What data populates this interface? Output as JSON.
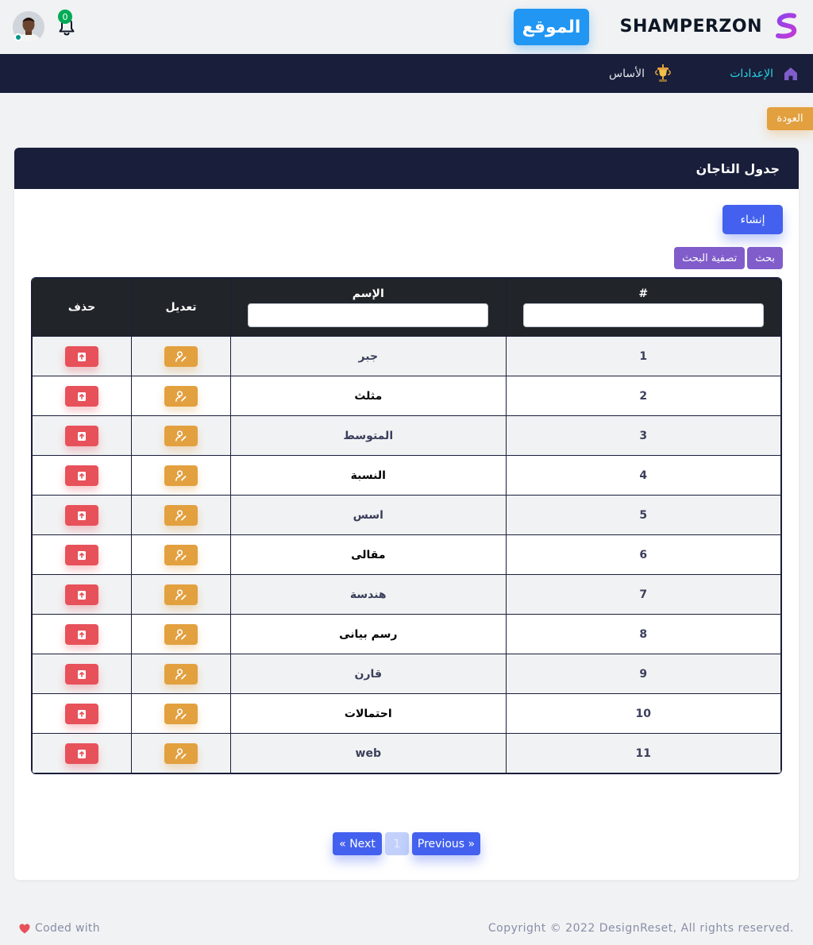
{
  "header": {
    "brand_name": "SHAMPERZON",
    "site_button": "الموقع",
    "notification_count": "0"
  },
  "nav": {
    "settings": "الإعدادات",
    "base": "الأساس"
  },
  "back_button": "العودة",
  "card": {
    "title": "جدول التاجان",
    "create_button": "إنشاء",
    "search_button": "بحث",
    "filter_button": "تصفية البحث"
  },
  "table": {
    "headers": {
      "num": "#",
      "name": "الإسم",
      "edit": "تعديل",
      "delete": "حذف"
    },
    "rows": [
      {
        "num": "1",
        "name": "جبر"
      },
      {
        "num": "2",
        "name": "مثلث"
      },
      {
        "num": "3",
        "name": "المتوسط"
      },
      {
        "num": "4",
        "name": "النسبة"
      },
      {
        "num": "5",
        "name": "اسس"
      },
      {
        "num": "6",
        "name": "مقالى"
      },
      {
        "num": "7",
        "name": "هندسة"
      },
      {
        "num": "8",
        "name": "رسم بيانى"
      },
      {
        "num": "9",
        "name": "قارن"
      },
      {
        "num": "10",
        "name": "احتمالات"
      },
      {
        "num": "11",
        "name": "web"
      }
    ]
  },
  "pagination": {
    "next": "« Next",
    "page": "1",
    "previous": "Previous »"
  },
  "footer": {
    "copyright": "Copyright © 2022 DesignReset, All rights reserved.",
    "coded_with": "Coded with"
  },
  "colors": {
    "primary": "#4361ee",
    "warning": "#e2a03f",
    "danger": "#e7515a",
    "secondary": "#805dca",
    "navbar": "#191e3a",
    "info": "#2196f3"
  }
}
